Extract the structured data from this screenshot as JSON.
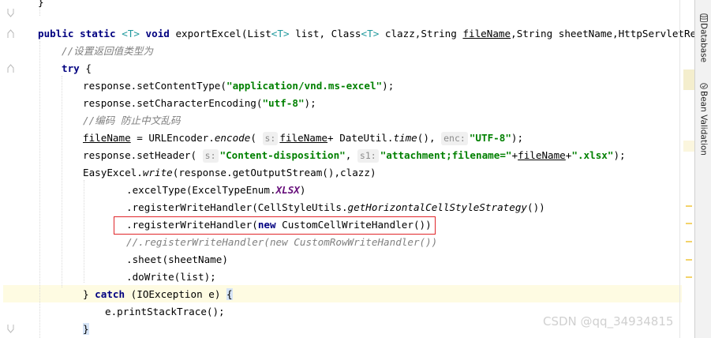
{
  "editor": {
    "lines": {
      "l0": "}",
      "l1_a": "public",
      "l1_b": "static",
      "l1_c": "<T>",
      "l1_d": "void",
      "l1_e": " exportExcel(List",
      "l1_f": "<T>",
      "l1_g": " list, Class",
      "l1_h": "<T>",
      "l1_i": " clazz,String ",
      "l1_j": "fileName",
      "l1_k": ",String sheetName,HttpServletResponse re",
      "l2": "//设置返回值类型为",
      "l3_a": "try",
      "l3_b": " {",
      "l4_a": "response.setContentType(",
      "l4_b": "\"application/vnd.ms-excel\"",
      "l4_c": ");",
      "l5_a": "response.setCharacterEncoding(",
      "l5_b": "\"utf-8\"",
      "l5_c": ");",
      "l6": "//编码 防止中文乱码",
      "l7_a": "fileName",
      "l7_b": " = URLEncoder.",
      "l7_c": "encode",
      "l7_d": "( ",
      "l7_hint1": "s:",
      "l7_e": "fileName",
      "l7_f": "+ DateUtil.",
      "l7_g": "time",
      "l7_h": "(), ",
      "l7_hint2": "enc:",
      "l7_i": "\"UTF-8\"",
      "l7_j": ");",
      "l8_a": "response.setHeader( ",
      "l8_hint1": "s:",
      "l8_b": "\"Content-disposition\"",
      "l8_c": ", ",
      "l8_hint2": "s1:",
      "l8_d": "\"attachment;filename=\"",
      "l8_e": "+",
      "l8_f": "fileName",
      "l8_g": "+",
      "l8_h": "\".xlsx\"",
      "l8_i": ");",
      "l9_a": "EasyExcel.",
      "l9_b": "write",
      "l9_c": "(response.getOutputStream(),clazz)",
      "l10_a": ".excelType(ExcelTypeEnum.",
      "l10_b": "XLSX",
      "l10_c": ")",
      "l11_a": ".registerWriteHandler(CellStyleUtils.",
      "l11_b": "getHorizontalCellStyleStrategy",
      "l11_c": "())",
      "l12_a": ".registerWriteHandler(",
      "l12_b": "new",
      "l12_c": " CustomCellWriteHandler())",
      "l13": "//.registerWriteHandler(new CustomRowWriteHandler())",
      "l14": ".sheet(sheetName)",
      "l15": ".doWrite(list);",
      "l16_a": "} ",
      "l16_b": "catch",
      "l16_c": " (IOException e) ",
      "l16_d": "{",
      "l17": "e.printStackTrace();",
      "l18": "}"
    }
  },
  "tool_windows": [
    {
      "label": "Database",
      "icon": "database-icon"
    },
    {
      "label": "Bean Validation",
      "icon": "bean-validation-icon"
    }
  ],
  "watermark": "CSDN @qq_34934815",
  "colors": {
    "keyword": "#000080",
    "string": "#008000",
    "comment": "#808080",
    "highlight_box": "#e0262a",
    "current_line": "#fefbe2"
  }
}
